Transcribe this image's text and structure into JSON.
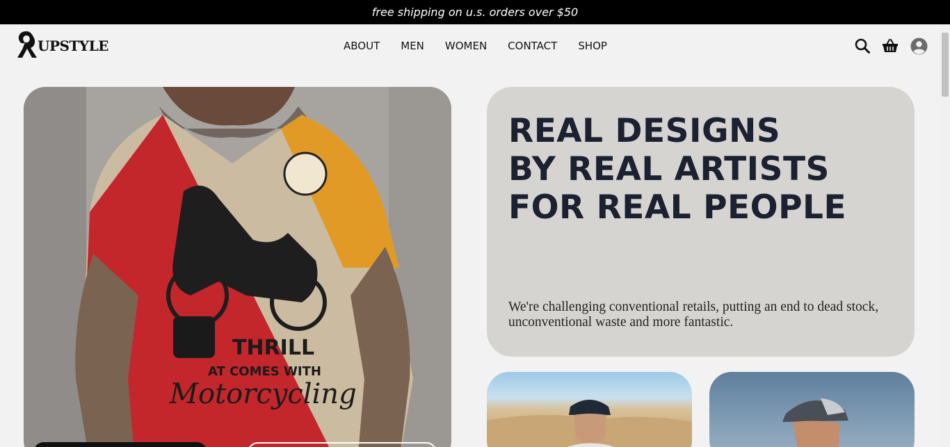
{
  "announcement": "free shipping on u.s. orders over $50",
  "brand": "UPSTYLE",
  "nav": [
    "ABOUT",
    "MEN",
    "WOMEN",
    "CONTACT",
    "SHOP"
  ],
  "icons": [
    "search-icon",
    "basket-icon",
    "account-icon"
  ],
  "hero": {
    "headline": [
      "REAL DESIGNS",
      "BY REAL ARTISTS",
      "FOR REAL PEOPLE"
    ],
    "subtext": "We're challenging conventional retails, putting an end to dead stock, unconventional waste and more fantastic."
  },
  "colors": {
    "announcement_bg": "#000000",
    "page_bg": "#f2f2f2",
    "card_bg": "#d6d4d1",
    "headline": "#1b2130"
  }
}
